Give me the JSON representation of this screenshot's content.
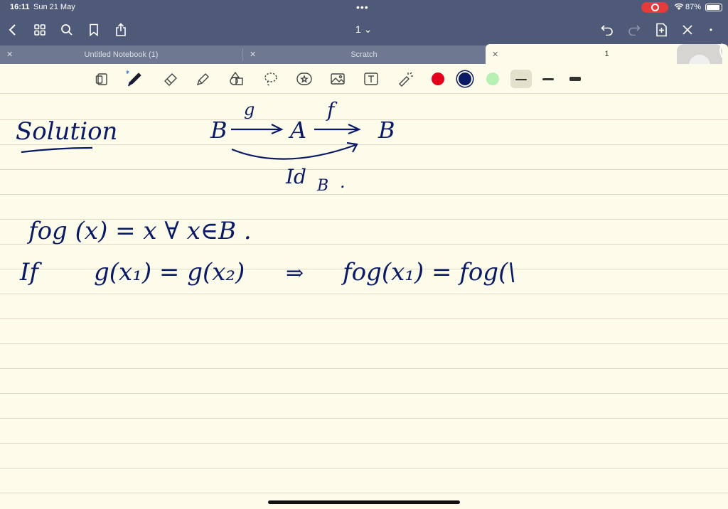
{
  "status": {
    "time": "16:11",
    "date": "Sun 21 May",
    "battery": "87%"
  },
  "nav": {
    "page_indicator": "1 ⌄"
  },
  "tabs": [
    {
      "label": "Untitled Notebook (1)"
    },
    {
      "label": "Scratch"
    },
    {
      "label": "1"
    }
  ],
  "toolbar": {
    "colors": [
      "#e4001b",
      "#0b1a64",
      "#b7f0b2"
    ],
    "tools": [
      "page-layout-icon",
      "pen-icon",
      "eraser-icon",
      "highlighter-icon",
      "shapes-icon",
      "lasso-icon",
      "sticker-icon",
      "image-icon",
      "text-icon",
      "laser-icon"
    ]
  },
  "handwriting": {
    "heading": "Solution",
    "diagram": {
      "left": "B",
      "middle": "A",
      "right": "B",
      "map1": "g",
      "map2": "f",
      "bottom": "Id",
      "bottom_sub": "B",
      "dot": "."
    },
    "line1": "fog (x) = x  ∀ x∈B .",
    "line2_if": "If",
    "line2_a": "g(x₁) = g(x₂)",
    "line2_b": "⇒",
    "line2_c": "fog(x₁)  =  fog(\\"
  }
}
